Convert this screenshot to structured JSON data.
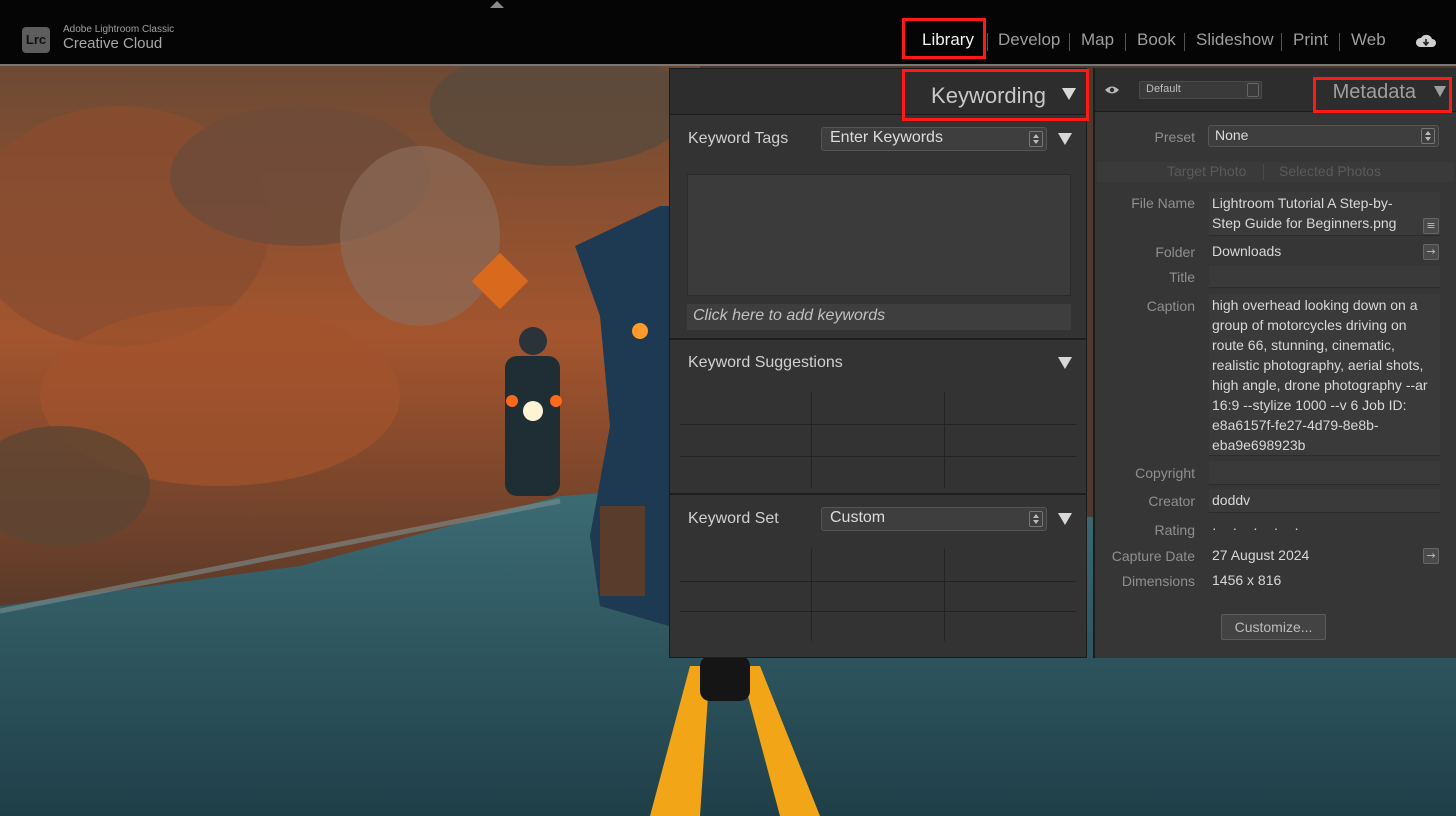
{
  "app": {
    "brand_small": "Adobe Lightroom Classic",
    "brand_big": "Creative Cloud",
    "logo_text": "Lrc"
  },
  "modules": [
    {
      "label": "Library",
      "active": true
    },
    {
      "label": "Develop",
      "active": false
    },
    {
      "label": "Map",
      "active": false
    },
    {
      "label": "Book",
      "active": false
    },
    {
      "label": "Slideshow",
      "active": false
    },
    {
      "label": "Print",
      "active": false
    },
    {
      "label": "Web",
      "active": false
    }
  ],
  "keywording": {
    "title": "Keywording",
    "keyword_tags_label": "Keyword Tags",
    "keyword_tags_select": "Enter Keywords",
    "add_placeholder": "Click here to add keywords",
    "suggestions_label": "Keyword Suggestions",
    "keyword_set_label": "Keyword Set",
    "keyword_set_select": "Custom"
  },
  "metadata": {
    "title": "Metadata",
    "view_default": "Default",
    "preset_label": "Preset",
    "preset_value": "None",
    "target_photo": "Target Photo",
    "selected_photos": "Selected Photos",
    "file_name_label": "File Name",
    "file_name_line1": "Lightroom Tutorial A Step-by-",
    "file_name_line2": "Step Guide for Beginners.png",
    "folder_label": "Folder",
    "folder_value": "Downloads",
    "title_label": "Title",
    "caption_label": "Caption",
    "caption_lines": [
      "high overhead looking down on a",
      "group of motorcycles driving on",
      "route 66, stunning, cinematic,",
      "realistic photography, aerial shots,",
      "high angle, drone photography --ar",
      "16:9 --stylize 1000 --v 6 Job ID:",
      "e8a6157f-fe27-4d79-8e8b-",
      "eba9e698923b"
    ],
    "copyright_label": "Copyright",
    "creator_label": "Creator",
    "creator_value": "doddv",
    "rating_label": "Rating",
    "rating_value": "· · · · ·",
    "capture_date_label": "Capture Date",
    "capture_date_value": "27 August 2024",
    "dimensions_label": "Dimensions",
    "dimensions_value": "1456 x 816",
    "customize_label": "Customize..."
  },
  "colors": {
    "highlight": "#ff1a1a",
    "panel_bg": "#333333",
    "topbar_bg": "#050505"
  },
  "icons": [
    "cloud-sync-icon",
    "eye-icon",
    "collapse-triangle-icon",
    "spinner-arrows-icon",
    "list-icon",
    "arrow-right-icon"
  ]
}
